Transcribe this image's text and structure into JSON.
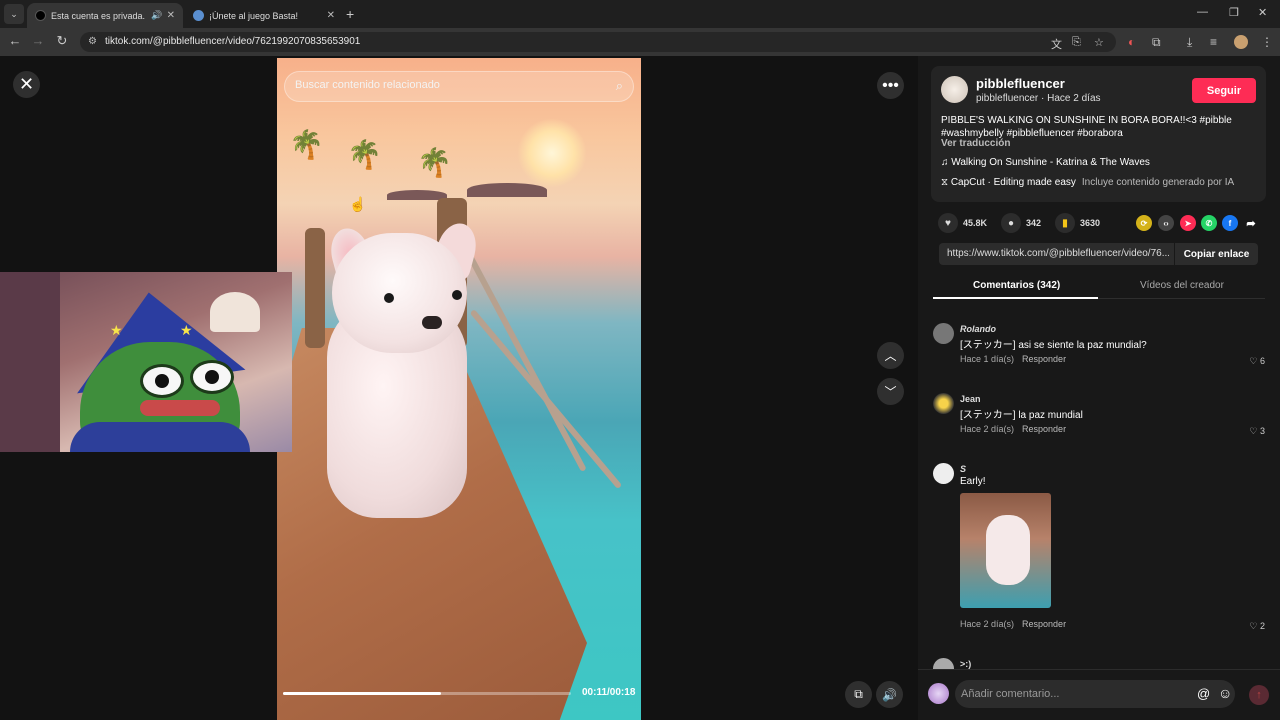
{
  "browser": {
    "tabs": [
      {
        "title": "Esta cuenta es privada. Sigu",
        "active": true
      },
      {
        "title": "¡Únete al juego Basta!",
        "active": false
      }
    ],
    "url": "tiktok.com/@pibblefluencer/video/7621992070835653901"
  },
  "video": {
    "search_placeholder": "Buscar contenido relacionado",
    "timecode": "00:11/00:18",
    "progress": 0.55
  },
  "post": {
    "author": "pibblefluencer",
    "author_sub": "pibblefluencer · Hace 2 días",
    "follow_label": "Seguir",
    "caption": "PIBBLE'S WALKING ON SUNSHINE IN BORA BORA!!<3 #pibble #washmybelly #pibblefluencer #borabora",
    "translate_label": "Ver traducción",
    "music": "Walking On Sunshine - Katrina & The Waves",
    "capcut": "CapCut · Editing made easy",
    "ai_note": "Incluye contenido generado por IA",
    "likes": "45.8K",
    "comments_count": "342",
    "saves": "3630",
    "link": "https://www.tiktok.com/@pibblefluencer/video/76...",
    "copy_label": "Copiar enlace"
  },
  "tabs": {
    "comments": "Comentarios (342)",
    "creator_videos": "Vídeos del creador"
  },
  "comments": [
    {
      "user": "Rolando",
      "text": "[ステッカー] asi se siente la paz mundial?",
      "time": "Hace 1 día(s)",
      "reply": "Responder",
      "likes": "6"
    },
    {
      "user": "Jean",
      "text": "[ステッカー] la paz mundial",
      "time": "Hace 2 día(s)",
      "reply": "Responder",
      "likes": "3"
    },
    {
      "user": "S",
      "text": "Early!",
      "time": "Hace 2 día(s)",
      "reply": "Responder",
      "likes": "2"
    },
    {
      "user": ">:)",
      "text": "",
      "time": "",
      "reply": "",
      "likes": ""
    }
  ],
  "comment_input": {
    "placeholder": "Añadir comentario..."
  }
}
